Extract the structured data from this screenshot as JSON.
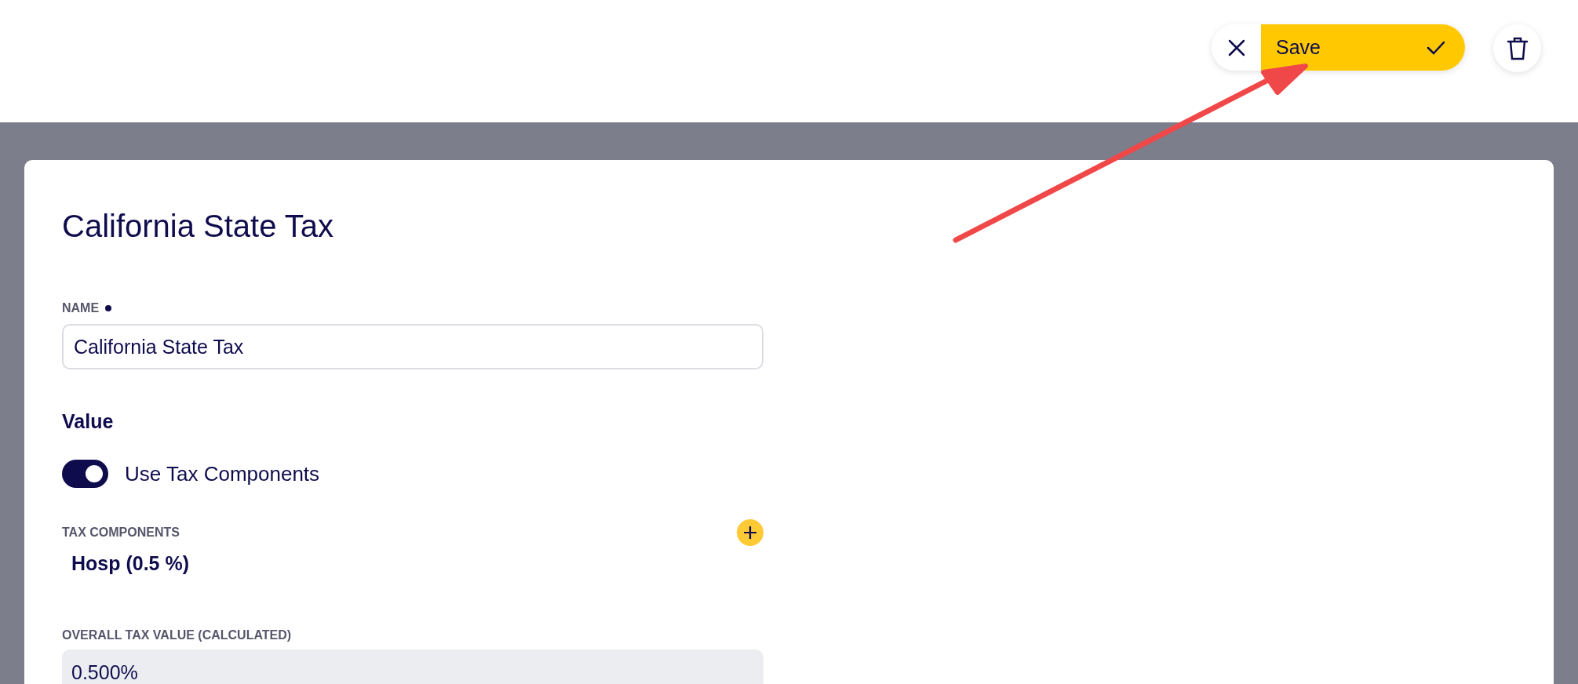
{
  "toolbar": {
    "save_label": "Save"
  },
  "form": {
    "title": "California State Tax",
    "name_field": {
      "label": "NAME",
      "required": true,
      "value": "California State Tax"
    },
    "value_section": {
      "heading": "Value",
      "toggle": {
        "label": "Use Tax Components",
        "on": true
      },
      "components_label": "TAX COMPONENTS",
      "components": [
        "Hosp (0.5 %)"
      ],
      "overall": {
        "label": "OVERALL TAX VALUE (CALCULATED)",
        "value": "0.500%",
        "disabled": true
      }
    }
  }
}
